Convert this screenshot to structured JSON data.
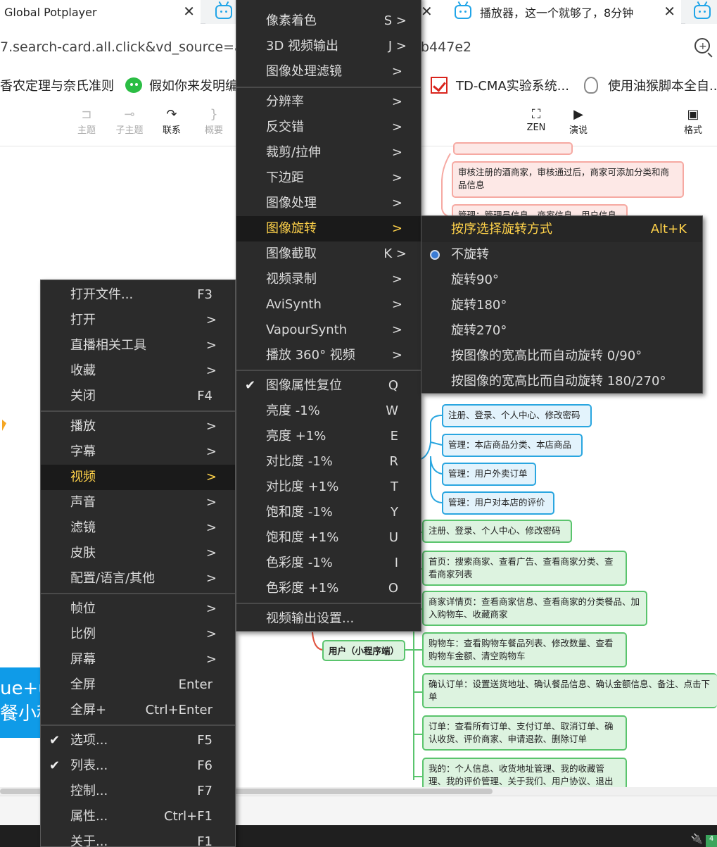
{
  "browser": {
    "tabs": [
      {
        "title": "Global Potplayer"
      },
      {
        "title": ""
      },
      {
        "title": "播放器，这一个就够了，8分钟"
      },
      {
        "title": ""
      }
    ],
    "url_left": "7.search-card.all.click&vd_source=a6",
    "url_right": "b447e2",
    "bookmarks": [
      {
        "label": "香农定理与奈氏准则"
      },
      {
        "label": "假如你来发明编"
      },
      {
        "label": "TD-CMA实验系统..."
      },
      {
        "label": "使用油猴脚本全自..."
      }
    ]
  },
  "toolbar": {
    "items": [
      {
        "icon": "topic-icon",
        "glyph": "⊐",
        "label": "主题"
      },
      {
        "icon": "subtopic-icon",
        "glyph": "⊸",
        "label": "子主题"
      },
      {
        "icon": "link-icon",
        "glyph": "↷",
        "label": "联系"
      },
      {
        "icon": "summary-icon",
        "glyph": "}",
        "label": "概要"
      },
      {
        "icon": "zen-icon",
        "glyph": "⛶",
        "label": "ZEN"
      },
      {
        "icon": "present-icon",
        "glyph": "▶",
        "label": "演说"
      },
      {
        "icon": "format-icon",
        "glyph": "▣",
        "label": "格式"
      }
    ]
  },
  "mindmap": {
    "pink_nodes": [
      "审核注册的酒商家，审核通过后，商家可添加分类和商品信息",
      "管理：管理员信息、商家信息、用户信息"
    ],
    "blue_nodes": [
      "注册、登录、个人中心、修改密码",
      "管理：本店商品分类、本店商品",
      "管理：用户外卖订单",
      "管理：用户对本店的评价"
    ],
    "user_node": "用户（小程序端）",
    "green_nodes": [
      "注册、登录、个人中心、修改密码",
      "首页：搜索商家、查看广告、查看商家分类、查看商家列表",
      "商家详情页：查看商家信息、查看商家的分类餐品、加入购物车、收藏商家",
      "购物车：查看购物车餐品列表、修改数量、查看购物车金额、清空购物车",
      "确认订单：设置送货地址、确认餐品信息、确认金额信息、备注、点击下单",
      "订单：查看所有订单、支付订单、取消订单、确认收货、评价商家、申请退款、删除订单",
      "我的：个人信息、收货地址管理、我的收藏管理、我的评价管理、关于我们、用户协议、退出"
    ],
    "banner_line1": "ue+u",
    "banner_line2": "餐小程"
  },
  "main_menu": {
    "items": [
      {
        "label": "打开文件...",
        "shortcut": "F3"
      },
      {
        "label": "打开",
        "arrow": ">"
      },
      {
        "label": "直播相关工具",
        "arrow": ">"
      },
      {
        "label": "收藏",
        "arrow": ">"
      },
      {
        "label": "关闭",
        "shortcut": "F4"
      },
      {
        "label": "播放",
        "arrow": ">"
      },
      {
        "label": "字幕",
        "arrow": ">"
      },
      {
        "label": "视频",
        "arrow": ">"
      },
      {
        "label": "声音",
        "arrow": ">"
      },
      {
        "label": "滤镜",
        "arrow": ">"
      },
      {
        "label": "皮肤",
        "arrow": ">"
      },
      {
        "label": "配置/语言/其他",
        "arrow": ">"
      },
      {
        "label": "帧位",
        "arrow": ">"
      },
      {
        "label": "比例",
        "arrow": ">"
      },
      {
        "label": "屏幕",
        "arrow": ">"
      },
      {
        "label": "全屏",
        "shortcut": "Enter"
      },
      {
        "label": "全屏+",
        "shortcut": "Ctrl+Enter"
      },
      {
        "label": "选项...",
        "shortcut": "F5"
      },
      {
        "label": "列表...",
        "shortcut": "F6"
      },
      {
        "label": "控制...",
        "shortcut": "F7"
      },
      {
        "label": "属性...",
        "shortcut": "Ctrl+F1"
      },
      {
        "label": "关于...",
        "shortcut": "F1"
      }
    ]
  },
  "video_menu": {
    "items": [
      {
        "label": "像素着色",
        "shortcut": "S >"
      },
      {
        "label": "3D 视频输出",
        "shortcut": "J >"
      },
      {
        "label": "图像处理滤镜",
        "arrow": ">"
      },
      {
        "label": "分辨率",
        "arrow": ">"
      },
      {
        "label": "反交错",
        "arrow": ">"
      },
      {
        "label": "裁剪/拉伸",
        "arrow": ">"
      },
      {
        "label": "下边距",
        "arrow": ">"
      },
      {
        "label": "图像处理",
        "arrow": ">"
      },
      {
        "label": "图像旋转",
        "arrow": ">"
      },
      {
        "label": "图像截取",
        "shortcut": "K >"
      },
      {
        "label": "视频录制",
        "arrow": ">"
      },
      {
        "label": "AviSynth",
        "arrow": ">"
      },
      {
        "label": "VapourSynth",
        "arrow": ">"
      },
      {
        "label": "播放 360° 视频",
        "arrow": ">"
      },
      {
        "label": "图像属性复位",
        "shortcut": "Q"
      },
      {
        "label": "亮度 -1%",
        "shortcut": "W"
      },
      {
        "label": "亮度 +1%",
        "shortcut": "E"
      },
      {
        "label": "对比度 -1%",
        "shortcut": "R"
      },
      {
        "label": "对比度 +1%",
        "shortcut": "T"
      },
      {
        "label": "饱和度 -1%",
        "shortcut": "Y"
      },
      {
        "label": "饱和度 +1%",
        "shortcut": "U"
      },
      {
        "label": "色彩度 -1%",
        "shortcut": "I"
      },
      {
        "label": "色彩度 +1%",
        "shortcut": "O"
      },
      {
        "label": "视频输出设置..."
      }
    ]
  },
  "rotate_menu": {
    "items": [
      {
        "label": "按序选择旋转方式",
        "shortcut": "Alt+K"
      },
      {
        "label": "不旋转"
      },
      {
        "label": "旋转90°"
      },
      {
        "label": "旋转180°"
      },
      {
        "label": "旋转270°"
      },
      {
        "label": "按图像的宽高比而自动旋转 0/90°"
      },
      {
        "label": "按图像的宽高比而自动旋转 180/270°"
      }
    ]
  },
  "colors": {
    "menu_bg": "#2b2b2b",
    "menu_highlight_text": "#ffd24a",
    "accent_blue": "#0f9be8"
  }
}
